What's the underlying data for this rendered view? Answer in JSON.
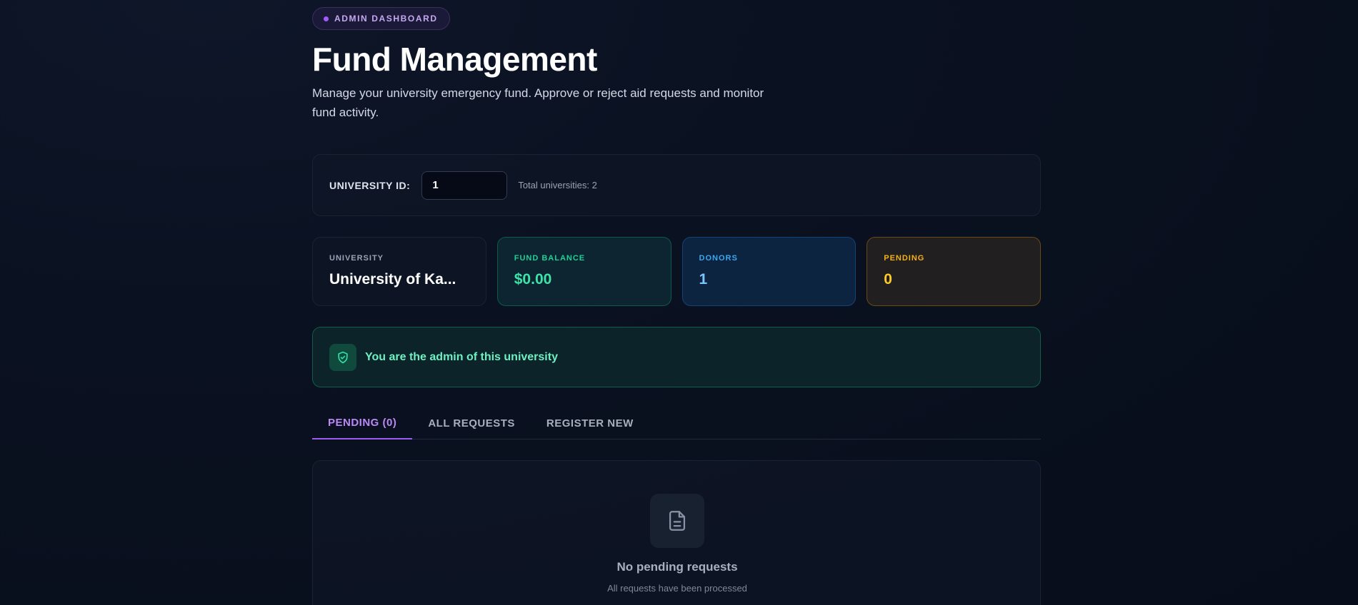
{
  "header": {
    "badge": "ADMIN DASHBOARD",
    "title": "Fund Management",
    "subtitle": "Manage your university emergency fund. Approve or reject aid requests and monitor fund activity."
  },
  "university_selector": {
    "label": "UNIVERSITY ID:",
    "value": "1",
    "total": "Total universities: 2"
  },
  "stats": {
    "university": {
      "label": "UNIVERSITY",
      "value": "University of Ka..."
    },
    "fund_balance": {
      "label": "FUND BALANCE",
      "value": "$0.00"
    },
    "donors": {
      "label": "DONORS",
      "value": "1"
    },
    "pending": {
      "label": "PENDING",
      "value": "0"
    }
  },
  "admin_notice": {
    "text": "You are the admin of this university",
    "icon": "shield-check-icon"
  },
  "tabs": [
    {
      "label": "PENDING (0)",
      "active": true
    },
    {
      "label": "ALL REQUESTS",
      "active": false
    },
    {
      "label": "REGISTER NEW",
      "active": false
    }
  ],
  "empty_state": {
    "icon": "document-icon",
    "title": "No pending requests",
    "subtitle": "All requests have been processed"
  },
  "colors": {
    "accent_purple": "#9b5ef2",
    "fund_green": "#3de3a9",
    "donors_blue": "#7cc6ff",
    "pending_amber": "#ffc928"
  }
}
